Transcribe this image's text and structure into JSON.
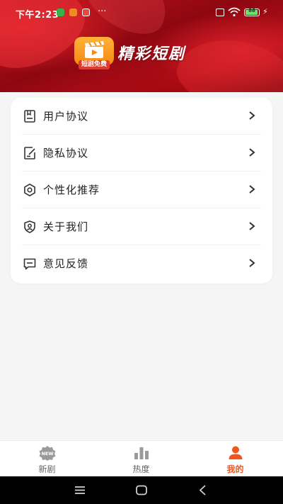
{
  "status_bar": {
    "time": "下午2:23",
    "more": "···",
    "battery": "86"
  },
  "header": {
    "logo_tag": "短剧免费",
    "brand": "精彩短剧"
  },
  "menu": {
    "items": [
      {
        "label": "用户协议",
        "icon": "document-icon"
      },
      {
        "label": "隐私协议",
        "icon": "edit-document-icon"
      },
      {
        "label": "个性化推荐",
        "icon": "gear-icon"
      },
      {
        "label": "关于我们",
        "icon": "user-shield-icon"
      },
      {
        "label": "意见反馈",
        "icon": "message-icon"
      }
    ]
  },
  "tabbar": {
    "tabs": [
      {
        "label": "新剧",
        "icon": "new-badge-icon",
        "active": false
      },
      {
        "label": "热度",
        "icon": "bar-chart-icon",
        "active": false
      },
      {
        "label": "我的",
        "icon": "person-icon",
        "active": true
      }
    ]
  },
  "colors": {
    "accent": "#f0561e",
    "header_red": "#b50f18",
    "page_bg": "#f5f5f5",
    "card_bg": "#ffffff"
  }
}
